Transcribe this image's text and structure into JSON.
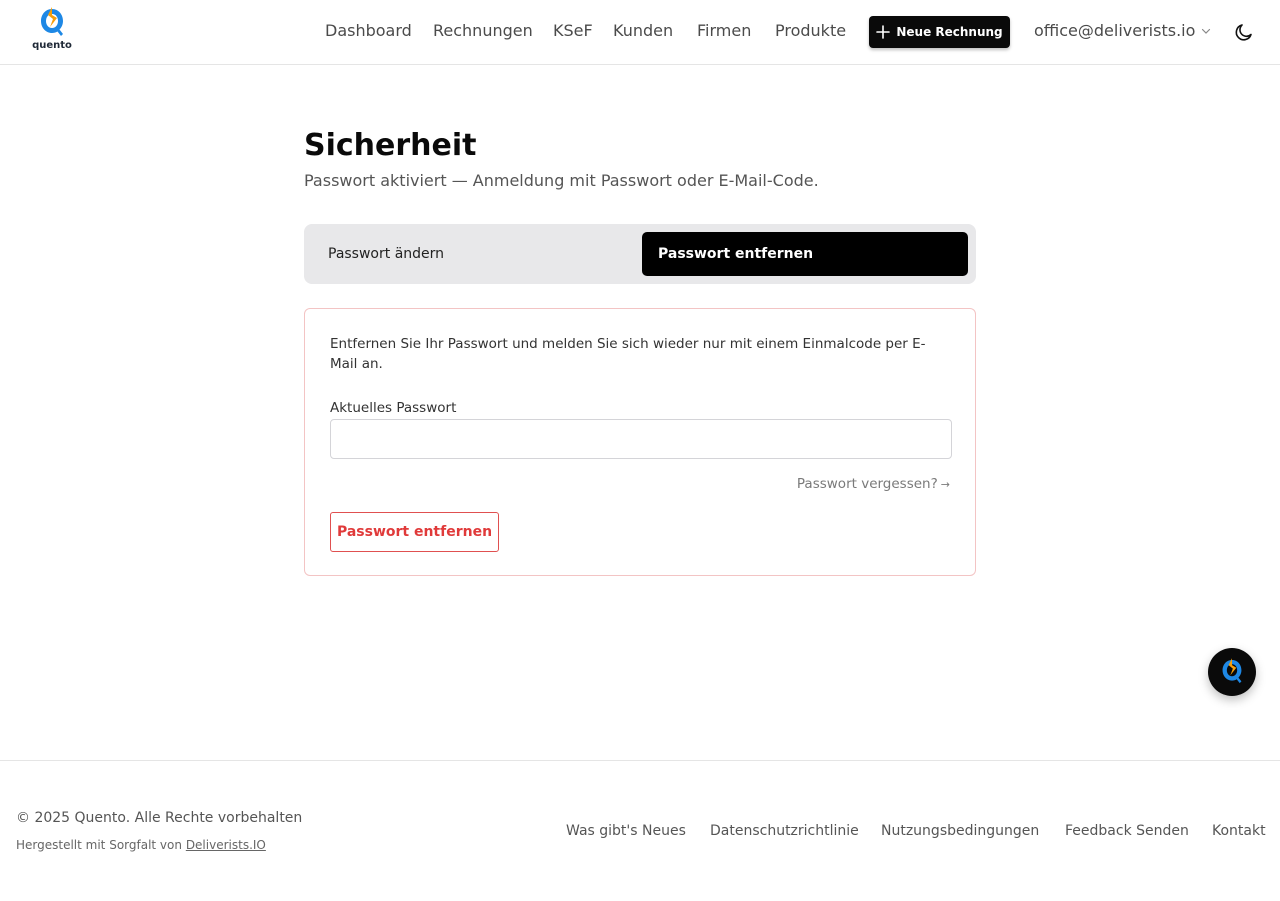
{
  "header": {
    "logo_text": "quento",
    "nav": [
      {
        "label": "Dashboard"
      },
      {
        "label": "Rechnungen"
      },
      {
        "label": "KSeF"
      },
      {
        "label": "Kunden"
      },
      {
        "label": "Firmen"
      },
      {
        "label": "Produkte"
      }
    ],
    "new_invoice_label": "Neue Rechnung",
    "new_invoice_icon": "plus-icon",
    "user_email": "office@deliverists.io",
    "user_menu_icon": "chevron-down-icon",
    "theme_icon": "moon-icon"
  },
  "main": {
    "title": "Sicherheit",
    "subtitle": "Passwort aktiviert — Anmeldung mit Passwort oder E-Mail-Code.",
    "tabs": [
      {
        "label": "Passwort ändern",
        "active": false
      },
      {
        "label": "Passwort entfernen",
        "active": true
      }
    ],
    "card": {
      "description": "Entfernen Sie Ihr Passwort und melden Sie sich wieder nur mit einem Einmalcode per E-Mail an.",
      "field_label": "Aktuelles Passwort",
      "field_value": "",
      "forgot_label": "Passwort vergessen?",
      "forgot_arrow": "→",
      "submit_label": "Passwort entfernen"
    }
  },
  "assistant": {
    "icon": "quento-assistant-icon"
  },
  "footer": {
    "copyright": "© 2025 Quento. Alle Rechte vorbehalten",
    "made_by_prefix": "Hergestellt mit Sorgfalt von",
    "made_by_link": "Deliverists.IO",
    "links": [
      {
        "label": "Was gibt's Neues"
      },
      {
        "label": "Datenschutzrichtlinie"
      },
      {
        "label": "Nutzungsbedingungen"
      },
      {
        "label": "Feedback Senden"
      },
      {
        "label": "Kontakt"
      }
    ]
  },
  "colors": {
    "primary": "#0a0a0a",
    "danger": "#e03a3a",
    "danger_border": "#f3c4c4",
    "logo_blue": "#1e88e5",
    "logo_orange": "#f59e0b"
  }
}
